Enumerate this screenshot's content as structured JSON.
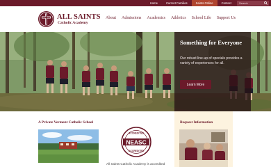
{
  "topbar": {
    "links": [
      {
        "label": "Home",
        "active": false
      },
      {
        "label": "Current Families",
        "active": false
      },
      {
        "label": "Saints Online",
        "active": true
      },
      {
        "label": "Contact",
        "active": false
      }
    ],
    "search_placeholder": "Search"
  },
  "header": {
    "brand_name": "ALL SAINTS",
    "brand_sub": "Catholic Academy",
    "nav": [
      "About",
      "Admissions",
      "Academics",
      "Athletics",
      "School Life",
      "Support Us"
    ]
  },
  "hero": {
    "title": "Something for Everyone",
    "body": "Our robust line-up of specials provides a variety of experiences for all.",
    "button_label": "Learn More"
  },
  "sections": {
    "vermont_heading": "A Private Vermont Catholic School",
    "vermont_caption": "",
    "neasc_text": "All Saints Catholic Academy is accredited",
    "neasc_seal": {
      "top": "ACCREDITED",
      "center": "NEASC",
      "bottom": "ACCREDITED"
    },
    "request_heading": "Request Information"
  },
  "colors": {
    "brand": "#6b1a2a",
    "accent": "#b0452f",
    "request_bg": "#fdf3df"
  }
}
